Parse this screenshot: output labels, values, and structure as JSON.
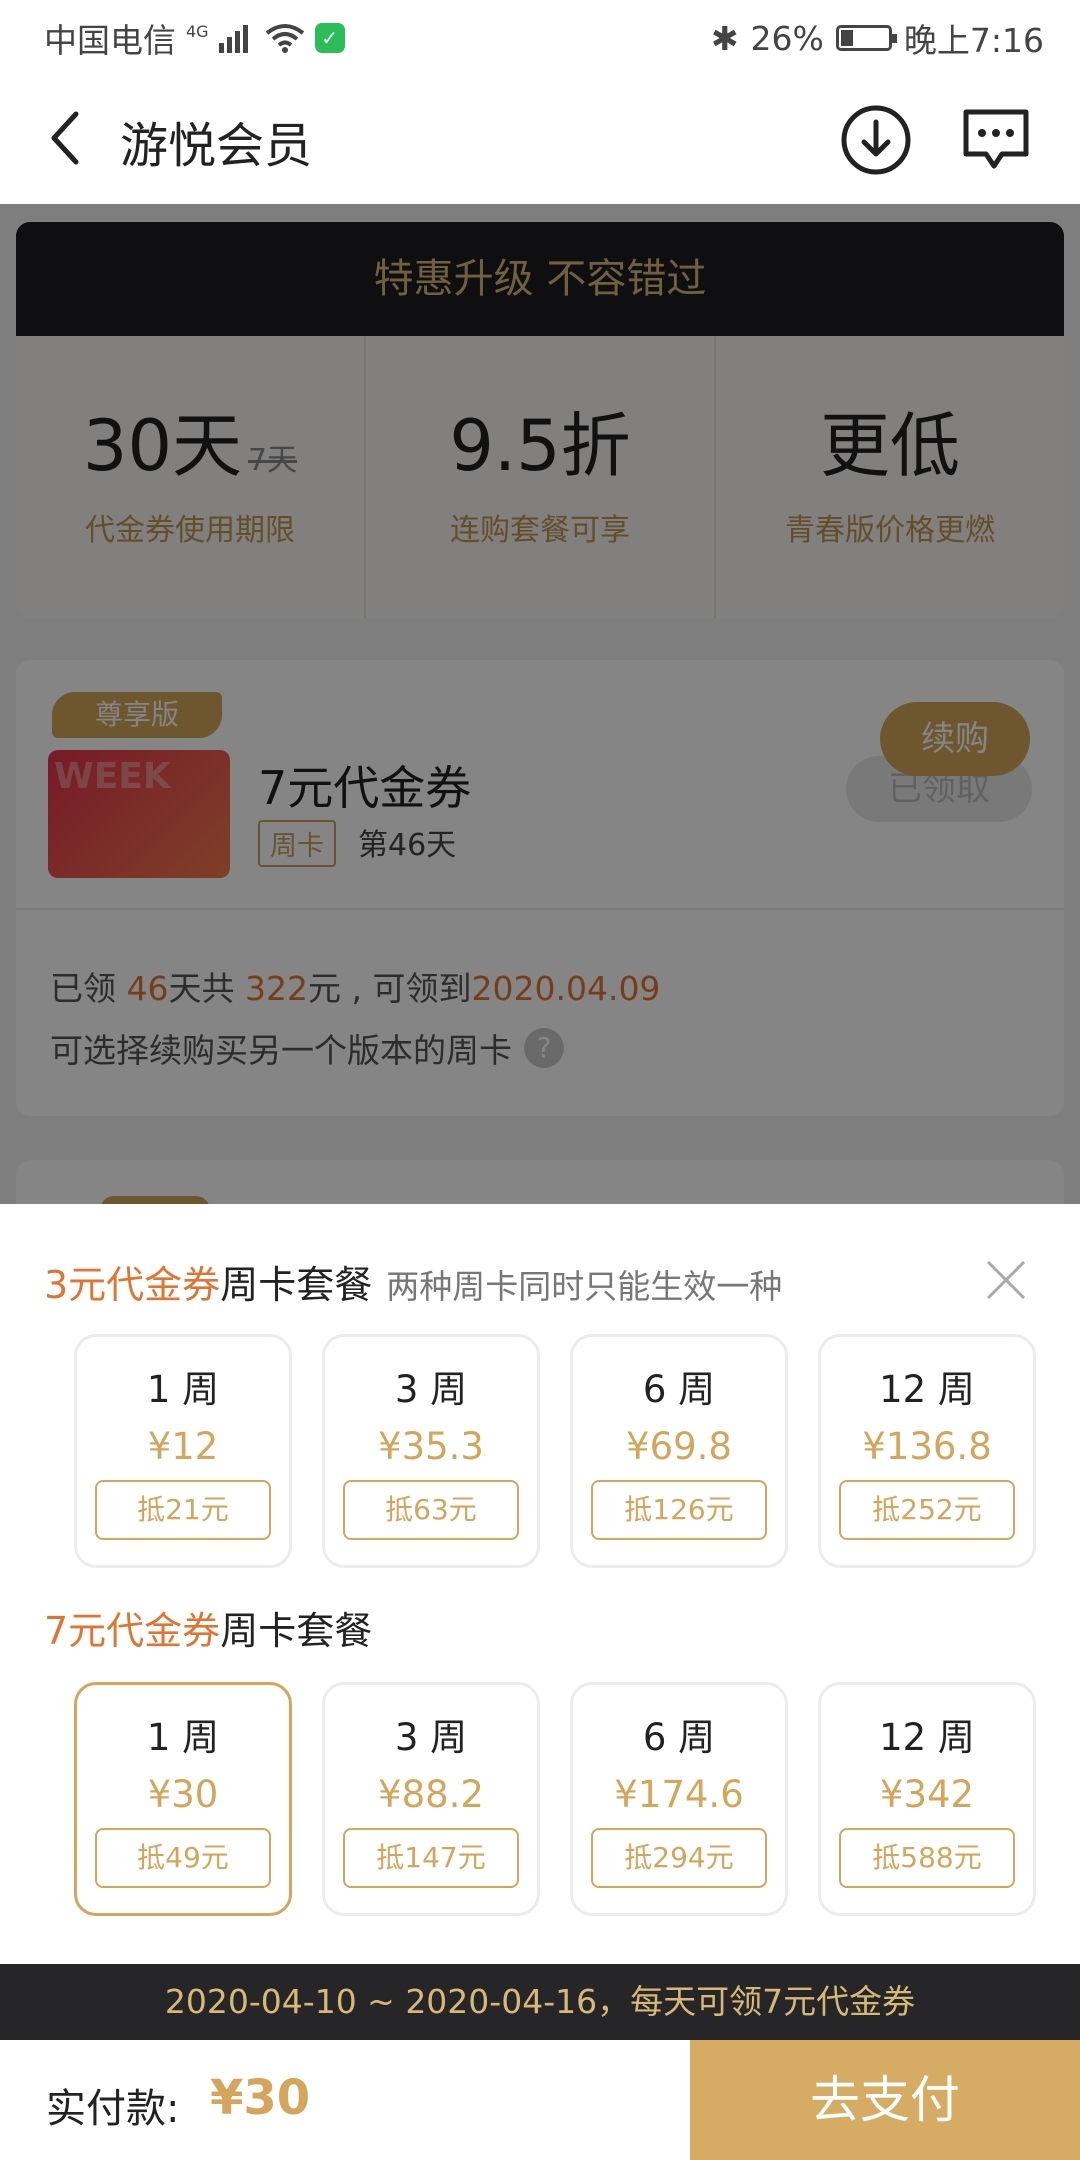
{
  "status_bar": {
    "carrier": "中国电信",
    "network": "4G",
    "battery": "26%",
    "battery_level": 0.26,
    "time": "晚上7:16"
  },
  "header": {
    "title": "游悦会员",
    "icons": [
      "back-arrow-icon",
      "download-icon",
      "message-icon"
    ]
  },
  "promo": {
    "banner": "特惠升级 不容错过",
    "cols": [
      {
        "big": "30天",
        "strike": "7天",
        "sub": "代金券使用期限"
      },
      {
        "big": "9.5折",
        "sub": "连购套餐可享"
      },
      {
        "big": "更低",
        "sub": "青春版价格更燃"
      }
    ]
  },
  "card": {
    "badge": "尊享版",
    "thumb_text": "WEEK",
    "name": "7元代金券",
    "tag": "周卡",
    "day": "第46天",
    "claimed": "已领取",
    "line1_a": "已领 ",
    "line1_days": "46",
    "line1_b": "天共 ",
    "line1_amount": "322",
    "line1_c": "元 , 可领到",
    "line1_date": "2020.04.09",
    "line2": "可选择续购买另一个版本的周卡",
    "renew": "续购"
  },
  "sheet": {
    "sec1": {
      "title_o": "3元代金券",
      "title_b": "周卡套餐",
      "note": "两种周卡同时只能生效一种"
    },
    "options1": [
      {
        "weeks": "1 周",
        "price": "¥12",
        "deduct": "抵21元"
      },
      {
        "weeks": "3 周",
        "price": "¥35.3",
        "deduct": "抵63元"
      },
      {
        "weeks": "6 周",
        "price": "¥69.8",
        "deduct": "抵126元"
      },
      {
        "weeks": "12 周",
        "price": "¥136.8",
        "deduct": "抵252元"
      }
    ],
    "sec2": {
      "title_o": "7元代金券",
      "title_b": "周卡套餐"
    },
    "options2": [
      {
        "weeks": "1 周",
        "price": "¥30",
        "deduct": "抵49元",
        "selected": true
      },
      {
        "weeks": "3 周",
        "price": "¥88.2",
        "deduct": "抵147元"
      },
      {
        "weeks": "6 周",
        "price": "¥174.6",
        "deduct": "抵294元"
      },
      {
        "weeks": "12 周",
        "price": "¥342",
        "deduct": "抵588元"
      }
    ],
    "notice": "2020-04-10 ~ 2020-04-16，每天可领7元代金券",
    "pay_label": "实付款:",
    "pay_amount": "¥30",
    "pay_button": "去支付"
  },
  "colors": {
    "accent": "#d4a55a",
    "orange": "#e07533",
    "dark": "#262628"
  }
}
